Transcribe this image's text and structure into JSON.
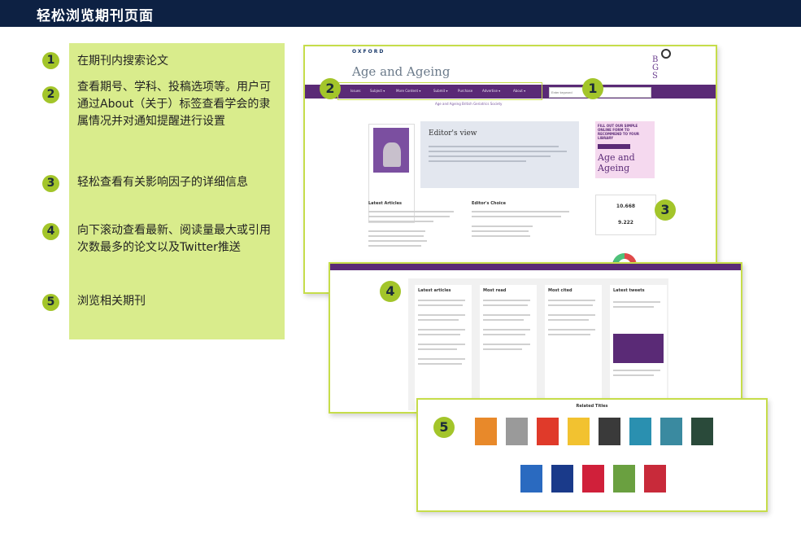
{
  "header": {
    "title": "轻松浏览期刊页面"
  },
  "legend": [
    {
      "num": "1",
      "text": "在期刊内搜索论文"
    },
    {
      "num": "2",
      "text": "查看期号、学科、投稿选项等。用户可通过About（关于）标签查看学会的隶属情况并对通知提醒进行设置"
    },
    {
      "num": "3",
      "text": "轻松查看有关影响因子的详细信息"
    },
    {
      "num": "4",
      "text": "向下滚动查看最新、阅读量最大或引用次数最多的论文以及Twitter推送"
    },
    {
      "num": "5",
      "text": "浏览相关期刊"
    }
  ],
  "screenshot1": {
    "publisher": "OXFORD",
    "journal": "Age and Ageing",
    "nav": [
      "Issues",
      "Subject ▾",
      "More Content ▾",
      "Submit ▾",
      "Purchase",
      "Advertise ▾",
      "About ▾"
    ],
    "search_placeholder": "Enter keyword",
    "subnav": "Age and Ageing   British Geriatrics Society",
    "editors_choice": "Editor's view",
    "latest_articles": "Latest Articles",
    "editors_choice_col": "Editor's Choice",
    "ad_text": "FILL OUT OUR SIMPLE ONLINE FORM TO RECOMMEND TO YOUR LIBRARY",
    "ad_journal": "Age and Ageing",
    "impact_factor": "10.668",
    "five_year_if": "9.222"
  },
  "screenshot2": {
    "cols": [
      "Latest articles",
      "Most read",
      "Most cited",
      "Latest tweets"
    ]
  },
  "screenshot3": {
    "title": "Related Titles"
  },
  "callouts": {
    "c1": "1",
    "c2": "2",
    "c3": "3",
    "c4": "4",
    "c5": "5"
  },
  "colors": {
    "header_bg": "#0d2143",
    "legend_bg": "#d9ec8c",
    "badge": "#a3c52a",
    "nav_purple": "#5a2a76",
    "frame": "#c6dd4a"
  }
}
